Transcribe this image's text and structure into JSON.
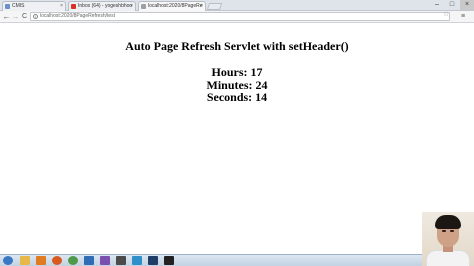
{
  "browser": {
    "tabs": [
      {
        "label": "CMIS",
        "favicon_color": "#6b8fc7",
        "active": false
      },
      {
        "label": "Inbox (64) - yogeshbhoo",
        "favicon_color": "#d93025",
        "active": false
      },
      {
        "label": "localhost:2020/8PageRe",
        "favicon_color": "#9aa0a6",
        "active": true
      }
    ],
    "address_bar": {
      "url": "localhost:2020/8PageRefresh/test"
    },
    "nav": {
      "back_glyph": "←",
      "forward_glyph": "→",
      "reload_glyph": "C"
    },
    "window_controls": {
      "minimize": "–",
      "maximize": "□",
      "close": "×"
    },
    "star_glyph": "☆",
    "menu_glyph": "≡"
  },
  "page": {
    "heading": "Auto Page Refresh Servlet with setHeader()",
    "hours_line": "Hours: 17",
    "minutes_line": "Minutes: 24",
    "seconds_line": "Seconds: 14"
  },
  "taskbar": {
    "icons": [
      {
        "name": "start-orb-icon",
        "color": "#3a78c4"
      },
      {
        "name": "explorer-icon",
        "color": "#e6b84a"
      },
      {
        "name": "media-player-icon",
        "color": "#e07b22"
      },
      {
        "name": "firefox-icon",
        "color": "#d85a1e"
      },
      {
        "name": "chrome-icon",
        "color": "#4c9a4a"
      },
      {
        "name": "app-icon-1",
        "color": "#2e6db5"
      },
      {
        "name": "app-icon-2",
        "color": "#7a4fb0"
      },
      {
        "name": "app-icon-3",
        "color": "#4b4b4b"
      },
      {
        "name": "app-icon-4",
        "color": "#2f8fc9"
      },
      {
        "name": "app-icon-5",
        "color": "#1f3d66"
      },
      {
        "name": "terminal-icon",
        "color": "#222222"
      }
    ]
  }
}
